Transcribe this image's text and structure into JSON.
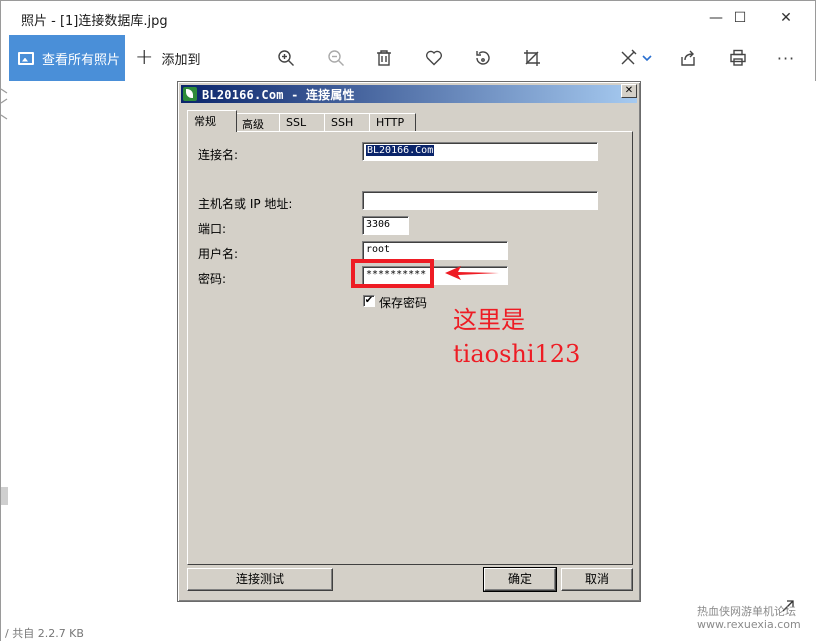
{
  "window": {
    "title": "照片 - [1]连接数据库.jpg",
    "minimize_glyph": "—",
    "maximize_glyph": "☐",
    "close_glyph": "✕"
  },
  "toolbar": {
    "view_all_label": "查看所有照片",
    "add_to_label": "添加到",
    "more_glyph": "···",
    "icons": [
      "zoom-in-icon",
      "zoom-out-icon",
      "delete-icon",
      "favorite-icon",
      "rotate-icon",
      "crop-icon",
      "edit-icon",
      "share-icon",
      "print-icon",
      "more-icon"
    ],
    "accent_color": "#4a8fd8"
  },
  "dialog": {
    "title": "BL20166.Com - 连接属性",
    "close_glyph": "✕",
    "tabs": [
      {
        "label": "常规"
      },
      {
        "label": "高级"
      },
      {
        "label": "SSL"
      },
      {
        "label": "SSH"
      },
      {
        "label": "HTTP"
      }
    ],
    "active_tab": "常规",
    "fields": {
      "connection_name_label": "连接名:",
      "connection_name_value": "BL20166.Com",
      "host_label": "主机名或 IP 地址:",
      "host_value": "",
      "port_label": "端口:",
      "port_value": "3306",
      "user_label": "用户名:",
      "user_value": "root",
      "password_label": "密码:",
      "password_value": "**********",
      "save_password_label": "保存密码",
      "save_password_checked_glyph": "✔"
    },
    "buttons": {
      "test_label": "连接测试",
      "ok_label": "确定",
      "cancel_label": "取消"
    }
  },
  "annotation": {
    "line1": "这里是",
    "line2": "tiaoshi123",
    "color": "#ee1c24"
  },
  "watermark": {
    "line1": "热血侠网游单机论坛",
    "line2": "www.rexuexia.com"
  },
  "bottom_text": "/ 共自 2.2.7 KB"
}
